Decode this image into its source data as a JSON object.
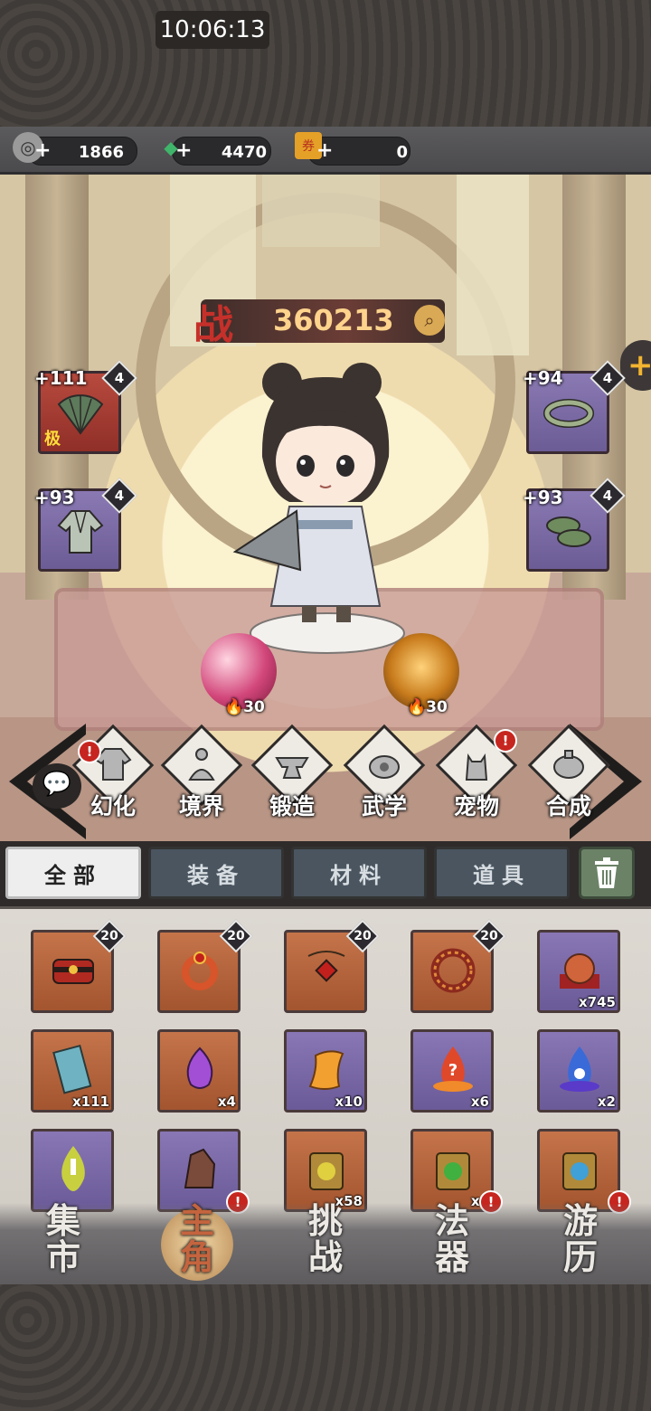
{
  "status_bar": {
    "time": "10:06:13"
  },
  "currencies": [
    {
      "name": "coin",
      "icon": "coin-icon",
      "value": "1866"
    },
    {
      "name": "jade",
      "icon": "jade-icon",
      "value": "4470"
    },
    {
      "name": "ticket",
      "icon": "ticket-icon",
      "value": "0"
    }
  ],
  "power": {
    "label": "战",
    "value": "360213"
  },
  "equipment": {
    "left": [
      {
        "name": "fan",
        "bonus": "+111",
        "level": "4",
        "grade": "极",
        "rarity": "red"
      },
      {
        "name": "robe",
        "bonus": "+93",
        "level": "4",
        "grade": "",
        "rarity": "purple"
      }
    ],
    "right": [
      {
        "name": "belt",
        "bonus": "+94",
        "level": "4",
        "rarity": "purple"
      },
      {
        "name": "shoes",
        "bonus": "+93",
        "level": "4",
        "rarity": "purple"
      }
    ]
  },
  "orbs": [
    {
      "name": "pink-orb",
      "value": "30"
    },
    {
      "name": "gold-orb",
      "value": "30"
    }
  ],
  "menu": [
    {
      "label": "幻化",
      "alert": true
    },
    {
      "label": "境界",
      "alert": false
    },
    {
      "label": "锻造",
      "alert": false
    },
    {
      "label": "武学",
      "alert": false
    },
    {
      "label": "宠物",
      "alert": true
    },
    {
      "label": "合成",
      "alert": false
    }
  ],
  "tabs": [
    "全部",
    "装备",
    "材料",
    "道具"
  ],
  "active_tab": "全部",
  "inventory": [
    {
      "name": "red-chest",
      "rarity": "orange",
      "level": "20",
      "count": ""
    },
    {
      "name": "fire-ring",
      "rarity": "orange",
      "level": "20",
      "count": ""
    },
    {
      "name": "red-amulet",
      "rarity": "orange",
      "level": "20",
      "count": ""
    },
    {
      "name": "fire-bracelet",
      "rarity": "orange",
      "level": "20",
      "count": ""
    },
    {
      "name": "orange-orb",
      "rarity": "purple",
      "level": "",
      "count": "x745"
    },
    {
      "name": "blue-scroll",
      "rarity": "orange",
      "level": "",
      "count": "x111"
    },
    {
      "name": "purple-spirit",
      "rarity": "orange",
      "level": "",
      "count": "x4"
    },
    {
      "name": "yellow-scroll",
      "rarity": "purple",
      "level": "",
      "count": "x10"
    },
    {
      "name": "red-flame",
      "rarity": "purple",
      "level": "",
      "count": "x6"
    },
    {
      "name": "blue-flame",
      "rarity": "purple",
      "level": "",
      "count": "x2"
    },
    {
      "name": "yellow-flame",
      "rarity": "purple",
      "level": "",
      "count": ""
    },
    {
      "name": "ore-crystal",
      "rarity": "purple",
      "level": "",
      "count": ""
    },
    {
      "name": "yellow-gem-token",
      "rarity": "orange",
      "level": "",
      "count": "x58"
    },
    {
      "name": "green-gem-token",
      "rarity": "orange",
      "level": "",
      "count": "x4"
    },
    {
      "name": "blue-gem-token",
      "rarity": "orange",
      "level": "",
      "count": ""
    }
  ],
  "bottom_nav": [
    {
      "label1": "集",
      "label2": "市",
      "active": false
    },
    {
      "label1": "主",
      "label2": "角",
      "active": true
    },
    {
      "label1": "挑",
      "label2": "战",
      "active": false
    },
    {
      "label1": "法",
      "label2": "器",
      "active": false
    },
    {
      "label1": "游",
      "label2": "历",
      "active": false
    }
  ],
  "colors": {
    "power_text": "#ffd38c",
    "power_char": "#c6302a",
    "alert": "#c6261f",
    "rarity_orange": "#c5744a",
    "rarity_purple": "#8977b5",
    "rarity_red": "#b84a3e"
  }
}
